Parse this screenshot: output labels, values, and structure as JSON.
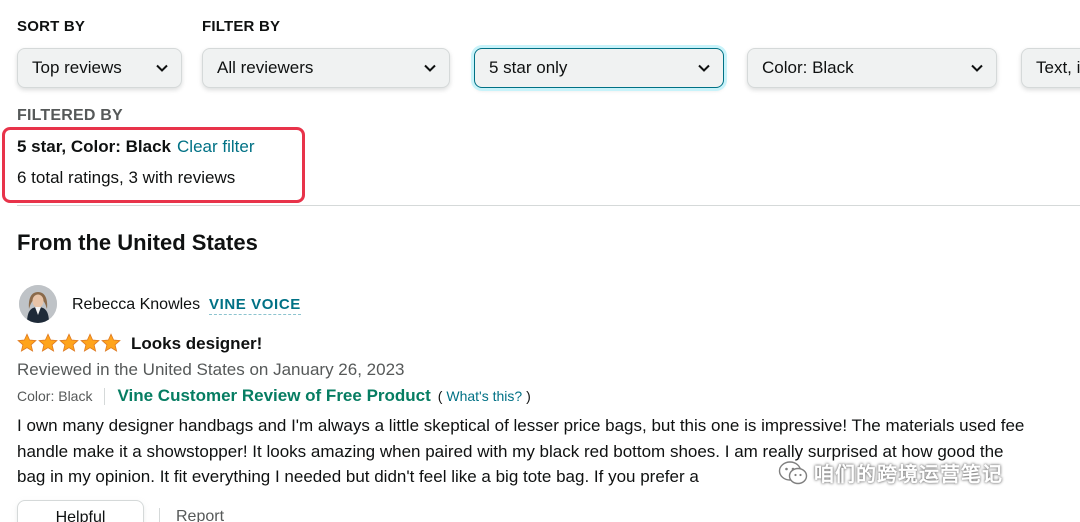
{
  "sort": {
    "heading": "SORT BY",
    "selected": "Top reviews"
  },
  "filter": {
    "heading": "FILTER BY",
    "reviewers": "All reviewers",
    "star_rating": "5 star only",
    "color": "Color: Black",
    "format": "Text, i"
  },
  "filtered_by": {
    "heading": "FILTERED BY",
    "criteria": "5 star, Color: Black",
    "clear_label": "Clear filter",
    "counts": "6 total ratings, 3 with reviews"
  },
  "region_heading": "From the United States",
  "review": {
    "reviewer_name": "Rebecca Knowles",
    "badge": "VINE VOICE",
    "rating": 5,
    "rating_max": 5,
    "title": "Looks designer!",
    "date": "Reviewed in the United States on January 26, 2023",
    "color": "Color: Black",
    "vine_label": "Vine Customer Review of Free Product",
    "whats_this_open": "(",
    "whats_this_link": "What's this?",
    "whats_this_close": ")",
    "body_lines": [
      "I own many designer handbags and I'm always a little skeptical of lesser price bags, but this one is impressive! The materials used fee",
      "handle make it a showstopper! It looks amazing when paired with my black red bottom shoes. I am really surprised at how good the",
      "bag in my opinion. It fit everything I needed but didn't feel like a big tote bag. If you prefer a"
    ],
    "helpful_label": "Helpful",
    "report_label": "Report"
  },
  "watermark": {
    "text": "咱们的跨境运营笔记"
  },
  "colors": {
    "link": "#007185",
    "vine_green": "#067d62",
    "highlight": "#e8334a",
    "star": "#ffa41c"
  },
  "icons": {
    "dropdown": "chevron-down-icon",
    "star": "star-icon",
    "watermark": "wechat-icon"
  }
}
